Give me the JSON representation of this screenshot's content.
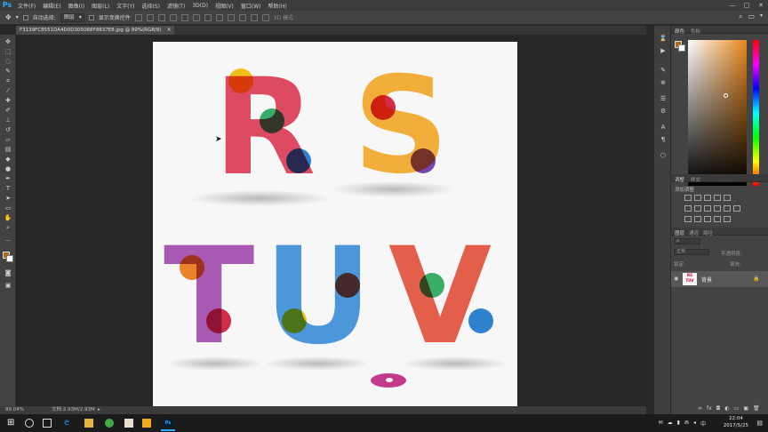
{
  "app": {
    "logo": "Ps"
  },
  "menu": [
    "文件(F)",
    "编辑(E)",
    "图像(I)",
    "图层(L)",
    "文字(Y)",
    "选择(S)",
    "滤镜(T)",
    "3D(D)",
    "视图(V)",
    "窗口(W)",
    "帮助(H)"
  ],
  "window_controls": [
    "—",
    "□",
    "✕"
  ],
  "options_bar": {
    "auto_select_label": "自动选择:",
    "auto_select_value": "图层",
    "show_transform_label": "显示变换控件",
    "mode_3d_label": "3D 模式:"
  },
  "document": {
    "tab_title": "F3139FC8551DA4D0D305068F8837E8.jpg @ 89%(RGB/8)",
    "tab_close": "×",
    "letters_top": [
      "R",
      "S"
    ],
    "letters_bottom": [
      "T",
      "U",
      "V"
    ]
  },
  "status_bar": {
    "zoom": "89.04%",
    "doc_info": "文档:2.93M/2.93M"
  },
  "panels": {
    "color_tab": "颜色",
    "swatches_tab": "色板",
    "adjustments_tab": "调整",
    "styles_tab": "样式",
    "add_adjustment": "添加调整",
    "layers_tab": "图层",
    "channels_tab": "通道",
    "paths_tab": "路径",
    "blend_mode": "正常",
    "opacity_label": "不透明度:",
    "lock_label": "锁定:",
    "fill_label": "填充:",
    "layer_name": "背景",
    "layer_thumb_text": "RS TUV"
  },
  "taskbar": {
    "time": "22:04",
    "date": "2017/5/25"
  },
  "colors": {
    "ps_blue": "#31a8ff",
    "chrome_dark": "#424242",
    "canvas_bg": "#f7f7f7",
    "foreground_color": "#b06a12"
  }
}
